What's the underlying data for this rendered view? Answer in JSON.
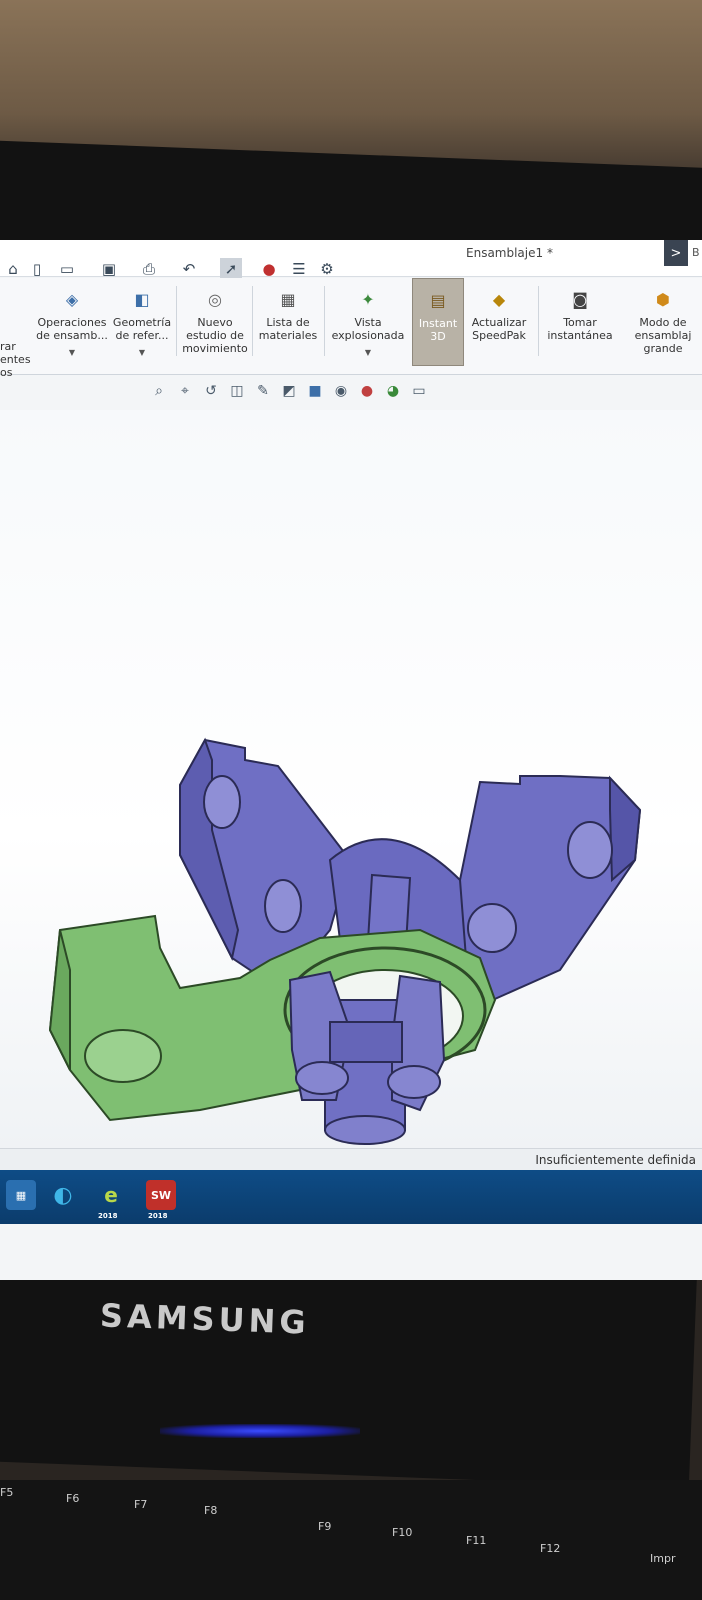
{
  "window": {
    "document_title": "Ensamblaje1 *",
    "command_glyph": ">",
    "command_suffix": "B"
  },
  "quick_access": {
    "icons": [
      "home-icon",
      "new-document-icon",
      "open-icon",
      "save-icon",
      "print-icon",
      "undo-icon",
      "select-icon",
      "traffic-light-icon",
      "file-properties-icon",
      "options-gear-icon"
    ]
  },
  "ribbon": {
    "partial_left": "rar\nentes\nos",
    "buttons": [
      {
        "label": "Operaciones\nde ensamb...",
        "icon": "assembly-features-icon"
      },
      {
        "label": "Geometría\nde refer...",
        "icon": "reference-geometry-icon"
      },
      {
        "label": "Nuevo\nestudio de\nmovimiento",
        "icon": "motion-study-icon"
      },
      {
        "label": "Lista de\nmateriales",
        "icon": "bill-of-materials-icon"
      },
      {
        "label": "Vista\nexplosionada",
        "icon": "exploded-view-icon"
      },
      {
        "label": "Instant\n3D",
        "icon": "instant3d-icon",
        "active": true
      },
      {
        "label": "Actualizar\nSpeedPak",
        "icon": "speedpak-icon"
      },
      {
        "label": "Tomar\ninstantánea",
        "icon": "snapshot-camera-icon"
      },
      {
        "label": "Modo de\nensamblaj\ngrande",
        "icon": "large-assembly-icon"
      }
    ]
  },
  "view_toolbar": {
    "icons": [
      "zoom-to-fit-icon",
      "zoom-area-icon",
      "previous-view-icon",
      "section-view-icon",
      "dynamic-annotation-icon",
      "view-orientation-icon",
      "display-style-icon",
      "hide-show-icon",
      "edit-appearance-icon",
      "apply-scene-icon",
      "view-settings-icon"
    ]
  },
  "status_bar": {
    "text": "Insuficientemente definida"
  },
  "taskbar": {
    "apps": [
      {
        "name": "start-icon",
        "label": ""
      },
      {
        "name": "edge-browser-icon",
        "label": ""
      },
      {
        "name": "edrawings-icon",
        "label": "e",
        "version": "2018"
      },
      {
        "name": "solidworks-icon",
        "label": "SW",
        "version": "2018"
      }
    ]
  },
  "monitor": {
    "brand": "SAMSUNG"
  },
  "keyboard": {
    "keys": [
      "F5",
      "F6",
      "F7",
      "F8",
      "F9",
      "F10",
      "F11",
      "F12",
      "Impr"
    ]
  },
  "colors": {
    "green_part": "#7fbf72",
    "blue_part": "#6f6fc4",
    "ribbon_active": "#b8b2a6",
    "taskbar": "#0e4c86"
  }
}
